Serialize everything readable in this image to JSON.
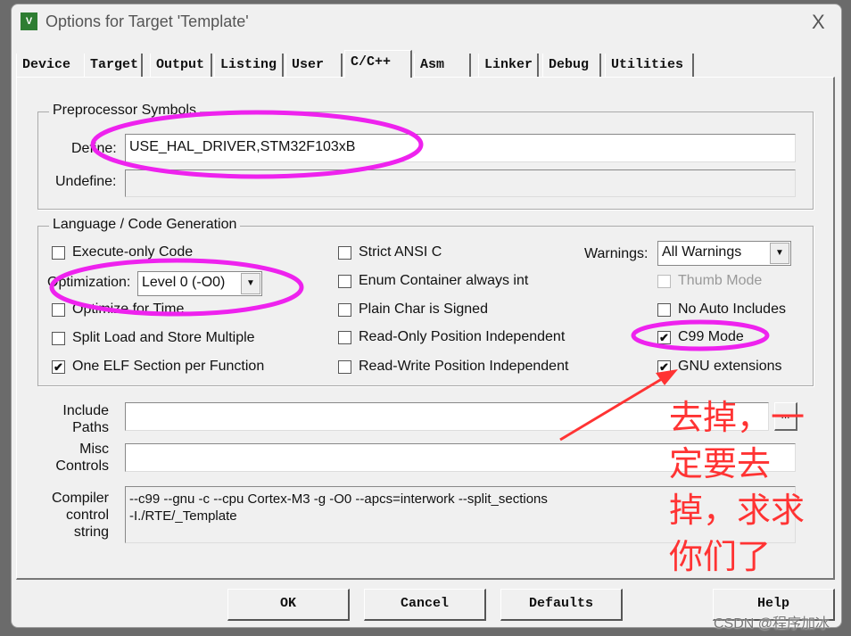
{
  "window": {
    "title": "Options for Target 'Template'",
    "close": "X"
  },
  "tabs": [
    "Device",
    "Target",
    "Output",
    "Listing",
    "User",
    "C/C++",
    "Asm",
    "Linker",
    "Debug",
    "Utilities"
  ],
  "preprocessor": {
    "group": "Preprocessor Symbols",
    "define_label": "Define:",
    "define_value": "USE_HAL_DRIVER,STM32F103xB",
    "undefine_label": "Undefine:",
    "undefine_value": ""
  },
  "language": {
    "group": "Language / Code Generation",
    "execute_only": "Execute-only Code",
    "optimization_label": "Optimization:",
    "optimization_value": "Level 0 (-O0)",
    "optimize_time": "Optimize for Time",
    "split_load": "Split Load and Store Multiple",
    "one_elf": "One ELF Section per Function",
    "strict_ansi": "Strict ANSI C",
    "enum_int": "Enum Container always int",
    "plain_char": "Plain Char is Signed",
    "ro_pi": "Read-Only Position Independent",
    "rw_pi": "Read-Write Position Independent",
    "warnings_label": "Warnings:",
    "warnings_value": "All Warnings",
    "thumb": "Thumb Mode",
    "no_auto": "No Auto Includes",
    "c99": "C99 Mode",
    "gnu": "GNU extensions",
    "check": "✔"
  },
  "paths": {
    "include_label": "Include Paths",
    "include_value": "",
    "browse": "...",
    "misc_label": "Misc Controls",
    "misc_value": "",
    "compiler_label": "Compiler control string",
    "compiler_line1": "--c99 --gnu -c --cpu Cortex-M3 -g -O0 --apcs=interwork --split_sections",
    "compiler_line2": "-I./RTE/_Template"
  },
  "buttons": {
    "ok": "OK",
    "cancel": "Cancel",
    "defaults": "Defaults",
    "help": "Help"
  },
  "annotation": {
    "line1": "去掉，一",
    "line2": "定要去",
    "line3": "掉，求求",
    "line4": "你们了",
    "color": "#ff3333",
    "ellipse_color": "#ee22ee"
  },
  "watermark": "CSDN @程序加冰"
}
